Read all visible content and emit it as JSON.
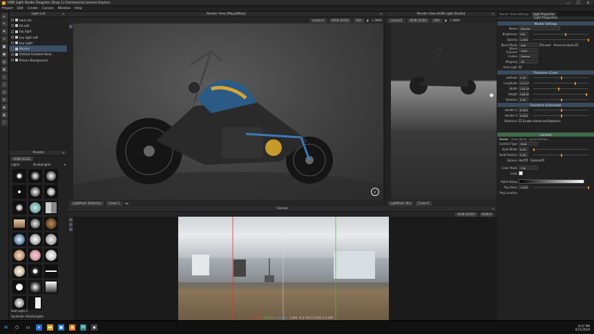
{
  "window": {
    "title": "HDR Light Studio Tungsten (Drop 1) Commercial License Expires:",
    "minimize": "—",
    "maximize": "☐",
    "close": "✕"
  },
  "menu": [
    "Project",
    "Edit",
    "Create",
    "Canvas",
    "Window",
    "Help"
  ],
  "light_list": {
    "title": "Light List",
    "items": [
      {
        "label": "hard rim",
        "selected": false
      },
      {
        "label": "fill soft",
        "selected": false
      },
      {
        "label": "top light",
        "selected": false
      },
      {
        "label": "key light soft",
        "selected": false
      },
      {
        "label": "key Light",
        "selected": false
      },
      {
        "label": "Blocker",
        "selected": true
      },
      {
        "label": "Default Gradient Back...",
        "selected": false
      },
      {
        "label": "Picture Background",
        "selected": false
      }
    ]
  },
  "presets": {
    "title": "Presets",
    "colorspace": "sRGB (ACES)",
    "category": "Lights",
    "library": "StudioLights",
    "footer_name": "Half Light 2",
    "footer_library": "Synthetic StudioLights"
  },
  "render_main": {
    "title": "Render View [Maya|Mtoa]",
    "camera": "camera1",
    "colorspace": "sRGB (ACES)",
    "mode": "HSV",
    "zoom": "1.0000",
    "lightpaint": "LightPaint: Reflection",
    "frame": "Frame 1"
  },
  "render_studio": {
    "title": "Render View [HDR Light Studio]",
    "camera": "camera1",
    "colorspace": "sRGB (ACES)",
    "mode": "HSV",
    "zoom": "1.0000",
    "lightpaint": "LightPaint: Rim",
    "frame": "Frame 6"
  },
  "canvas": {
    "title": "Canvas",
    "colorspace": "sRGB (ACES)",
    "channel": "RGB(A)",
    "readout_r": "R 0.289",
    "readout_g": "G 0.215",
    "readout_b": "B 0.186",
    "readout_a": "1.000",
    "readout_hv": "H 0.734 S 0.035 V 0.289"
  },
  "properties": {
    "tabs": [
      "Render View Settings",
      "Light Properties"
    ],
    "panel_title": "Light Properties",
    "master_settings": "Master Settings",
    "name_label": "Name",
    "name_value": "Blocker",
    "brightness_label": "Brightness",
    "brightness_value": "100",
    "opacity_label": "Opacity",
    "opacity_value": "1.000",
    "blend_mode_label": "Blend Mode",
    "blend_mode_value": "Add",
    "invert_label": "Invert",
    "preserve_alpha_label": "Preserve Alpha",
    "blend_channel_label": "Blend Channel",
    "blend_channel_value": "Color",
    "cookie_label": "Cookie",
    "cookie_value": "Square",
    "mapping_label": "Mapping",
    "mapping_value": "3D",
    "area_light_label": "Area Light",
    "transform_core": "Transform (Core)",
    "latitude_label": "Latitude",
    "latitude_value": "0.50",
    "longitude_label": "Longitude",
    "longitude_value": "270.17",
    "width_label": "Width",
    "width_value": "116.34",
    "height_label": "Height",
    "height_value": "248.87",
    "rotation_label": "Rotation",
    "rotation_value": "0.00",
    "transform_extended": "Transform (Extended)",
    "handle_u_label": "Handle U",
    "handle_u_value": "0.000",
    "handle_v_label": "Handle V",
    "handle_v_value": "0.000",
    "rotations_label": "Rotations",
    "enable_adv_label": "Enable Advanced Rotations",
    "content": "Content",
    "content_tabs": [
      "Master",
      "Value Blend",
      "Alpha Multiply"
    ],
    "content_type_label": "Content Type",
    "content_type_value": "Bulb",
    "bulb_width_label": "Bulb Width",
    "bulb_width_value": "0.00",
    "bulb_position_label": "Bulb Position",
    "bulb_position_value": "0.00",
    "options_label": "Options",
    "half_label": "Half",
    "outside_label": "Outside",
    "color_mode_label": "Color Mode",
    "color_mode_value": "Flat",
    "color_label": "Color",
    "alpha_ramp_label": "Alpha Ramp",
    "peg_value_label": "Peg Value",
    "peg_value_value": "1.000",
    "peg_location_label": "Peg Location"
  },
  "taskbar": {
    "time": "8:47 PM",
    "date": "4/11/2019"
  }
}
